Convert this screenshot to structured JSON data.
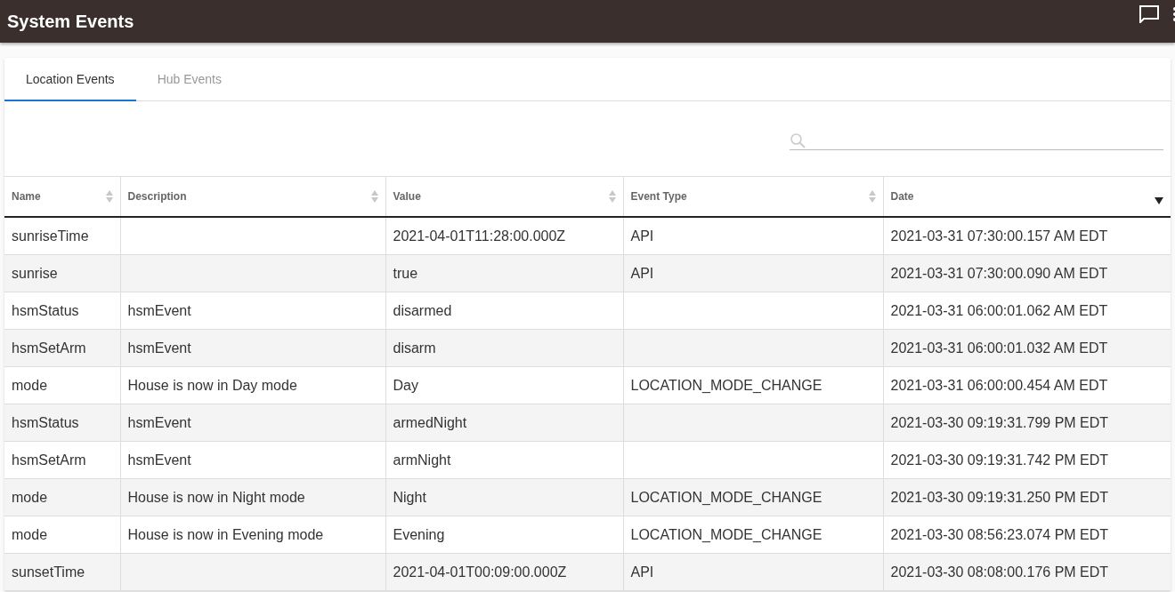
{
  "app_bar": {
    "title": "System Events"
  },
  "tabs": [
    {
      "label": "Location Events",
      "selected": true
    },
    {
      "label": "Hub Events",
      "selected": false
    }
  ],
  "table": {
    "columns": [
      {
        "label": "Name",
        "sorted": false
      },
      {
        "label": "Description",
        "sorted": false
      },
      {
        "label": "Value",
        "sorted": false
      },
      {
        "label": "Event Type",
        "sorted": false
      },
      {
        "label": "Date",
        "sorted": true
      }
    ],
    "rows": [
      [
        "sunriseTime",
        "",
        "2021-04-01T11:28:00.000Z",
        "API",
        "2021-03-31 07:30:00.157 AM EDT"
      ],
      [
        "sunrise",
        "",
        "true",
        "API",
        "2021-03-31 07:30:00.090 AM EDT"
      ],
      [
        "hsmStatus",
        "hsmEvent",
        "disarmed",
        "",
        "2021-03-31 06:00:01.062 AM EDT"
      ],
      [
        "hsmSetArm",
        "hsmEvent",
        "disarm",
        "",
        "2021-03-31 06:00:01.032 AM EDT"
      ],
      [
        "mode",
        "House is now in Day mode",
        "Day",
        "LOCATION_MODE_CHANGE",
        "2021-03-31 06:00:00.454 AM EDT"
      ],
      [
        "hsmStatus",
        "hsmEvent",
        "armedNight",
        "",
        "2021-03-30 09:19:31.799 PM EDT"
      ],
      [
        "hsmSetArm",
        "hsmEvent",
        "armNight",
        "",
        "2021-03-30 09:19:31.742 PM EDT"
      ],
      [
        "mode",
        "House is now in Night mode",
        "Night",
        "LOCATION_MODE_CHANGE",
        "2021-03-30 09:19:31.250 PM EDT"
      ],
      [
        "mode",
        "House is now in Evening mode",
        "Evening",
        "LOCATION_MODE_CHANGE",
        "2021-03-30 08:56:23.074 PM EDT"
      ],
      [
        "sunsetTime",
        "",
        "2021-04-01T00:09:00.000Z",
        "API",
        "2021-03-30 08:08:00.176 PM EDT"
      ]
    ]
  }
}
